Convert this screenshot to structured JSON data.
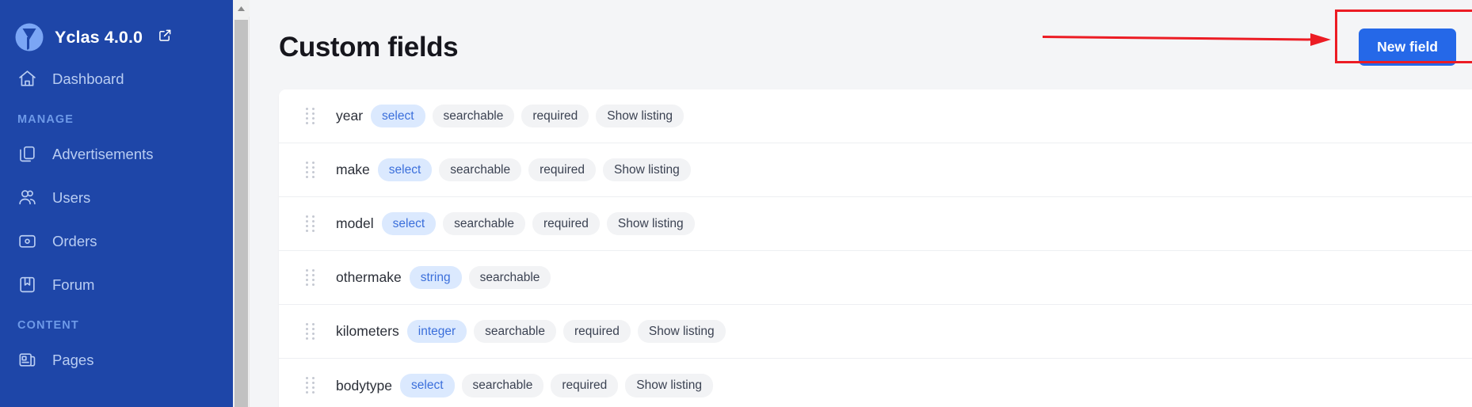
{
  "sidebar": {
    "brand": {
      "name": "Yclas 4.0.0",
      "external_link_icon": "external-link-icon",
      "logo_icon": "yclas-logo"
    },
    "items": [
      {
        "label": "Dashboard",
        "icon": "home-icon"
      }
    ],
    "sections": [
      {
        "label": "MANAGE",
        "items": [
          {
            "label": "Advertisements",
            "icon": "copy-icon"
          },
          {
            "label": "Users",
            "icon": "users-icon"
          },
          {
            "label": "Orders",
            "icon": "wallet-icon"
          },
          {
            "label": "Forum",
            "icon": "bookmark-icon"
          }
        ]
      },
      {
        "label": "CONTENT",
        "items": [
          {
            "label": "Pages",
            "icon": "newspaper-icon"
          }
        ]
      }
    ]
  },
  "header": {
    "title": "Custom fields",
    "new_field_label": "New field"
  },
  "fields": [
    {
      "name": "year",
      "type": "select",
      "badges": [
        "searchable",
        "required",
        "Show listing"
      ]
    },
    {
      "name": "make",
      "type": "select",
      "badges": [
        "searchable",
        "required",
        "Show listing"
      ]
    },
    {
      "name": "model",
      "type": "select",
      "badges": [
        "searchable",
        "required",
        "Show listing"
      ]
    },
    {
      "name": "othermake",
      "type": "string",
      "badges": [
        "searchable"
      ]
    },
    {
      "name": "kilometers",
      "type": "integer",
      "badges": [
        "searchable",
        "required",
        "Show listing"
      ]
    },
    {
      "name": "bodytype",
      "type": "select",
      "badges": [
        "searchable",
        "required",
        "Show listing"
      ]
    }
  ],
  "colors": {
    "sidebar_bg": "#1e46a8",
    "sidebar_text": "#b9cdf2",
    "sidebar_section": "#6e9ae8",
    "accent_button": "#2568e8",
    "badge_type_bg": "#dbe9fe",
    "badge_type_text": "#3b6fdb",
    "badge_plain_bg": "#f2f3f5",
    "badge_plain_text": "#3b4252",
    "page_bg": "#f4f5f7",
    "card_bg": "#ffffff",
    "annotation_red": "#ec1c24",
    "scrollbar_thumb": "#c1c1c1"
  },
  "annotations": {
    "arrow": "red-arrow-pointing-right",
    "highlight_box": "red-highlight-box-around-new-field-button"
  }
}
